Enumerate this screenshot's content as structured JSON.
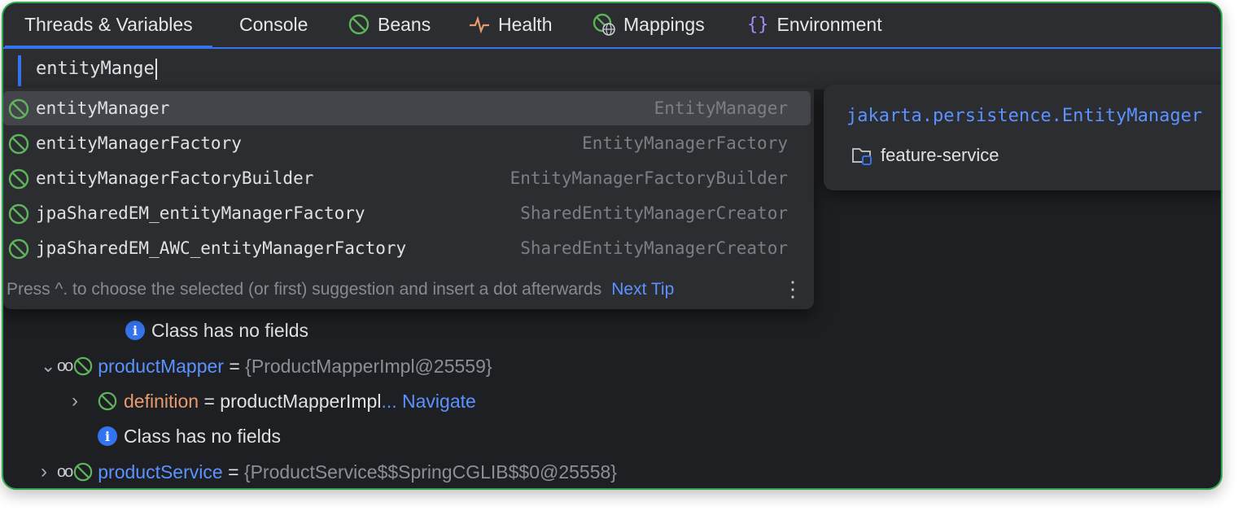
{
  "tabs": [
    {
      "label": "Threads & Variables",
      "icon": "none",
      "active": true
    },
    {
      "label": "Console",
      "icon": "none"
    },
    {
      "label": "Beans",
      "icon": "bean-icon"
    },
    {
      "label": "Health",
      "icon": "pulse-icon"
    },
    {
      "label": "Mappings",
      "icon": "mappings-globe-icon"
    },
    {
      "label": "Environment",
      "icon": "braces-icon"
    }
  ],
  "search": {
    "value": "entityMange"
  },
  "suggestions": [
    {
      "name": "entityManager",
      "type": "EntityManager"
    },
    {
      "name": "entityManagerFactory",
      "type": "EntityManagerFactory"
    },
    {
      "name": "entityManagerFactoryBuilder",
      "type": "EntityManagerFactoryBuilder"
    },
    {
      "name": "jpaSharedEM_entityManagerFactory",
      "type": "SharedEntityManagerCreator"
    },
    {
      "name": "jpaSharedEM_AWC_entityManagerFactory",
      "type": "SharedEntityManagerCreator"
    }
  ],
  "tip": {
    "text": "Press ^. to choose the selected (or first) suggestion and insert a dot afterwards",
    "link": "Next Tip",
    "more": "⋮"
  },
  "doc": {
    "fqn": "jakarta.persistence.EntityManager",
    "module": "feature-service"
  },
  "tree": {
    "no_fields_1": "Class has no fields",
    "product_mapper": {
      "name": "productMapper",
      "eq": "=",
      "value": "{ProductMapperImpl@25559}"
    },
    "definition": {
      "name": "definition",
      "eq": "=",
      "value": "productMapperImpl",
      "link": "... Navigate"
    },
    "no_fields_2": "Class has no fields",
    "product_service": {
      "name": "productService",
      "eq": "=",
      "value": "{ProductService$$SpringCGLIB$$0@25558}"
    }
  },
  "colors": {
    "accent": "#3574f0",
    "bean": "#5fb35a",
    "link": "#5c92ff",
    "orange": "#e89a6c",
    "frame": "#2fa84f"
  }
}
